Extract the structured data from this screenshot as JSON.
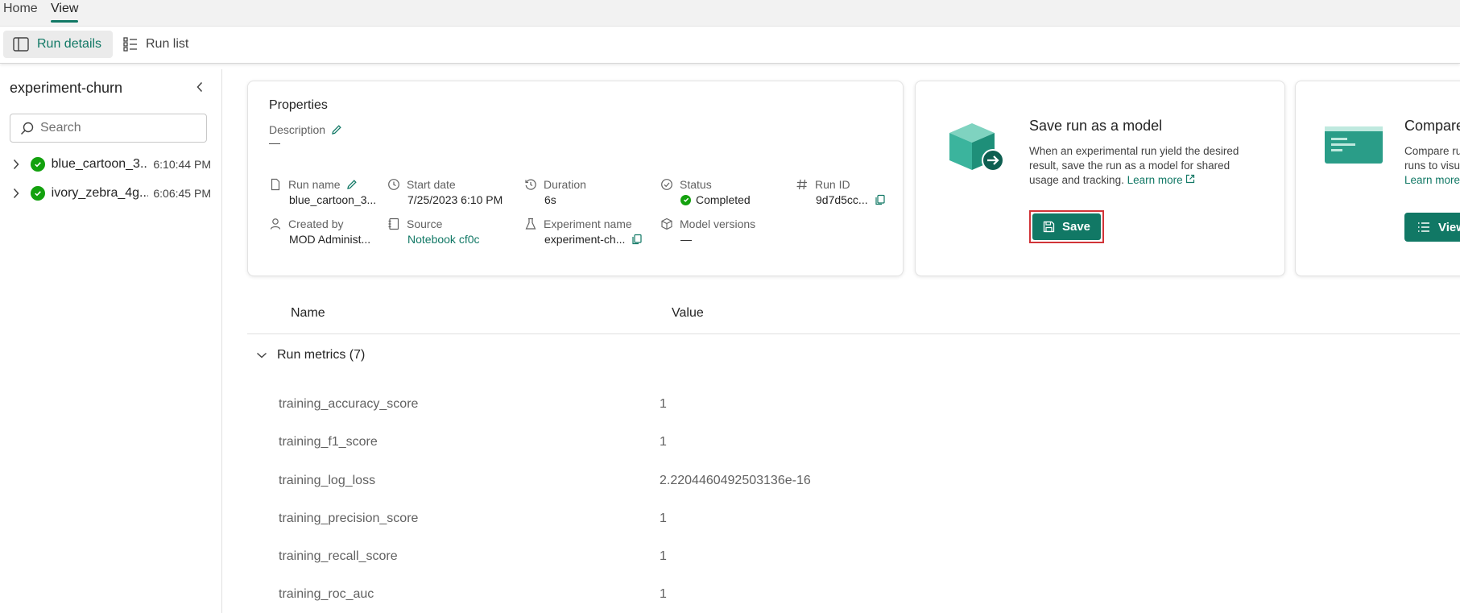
{
  "top_tabs": [
    {
      "label": "Home"
    },
    {
      "label": "View"
    }
  ],
  "ribbon": {
    "run_details": "Run details",
    "run_list": "Run list"
  },
  "sidebar": {
    "title": "experiment-churn",
    "search_placeholder": "Search",
    "runs": [
      {
        "name": "blue_cartoon_3...",
        "time": "6:10:44 PM",
        "status": "completed"
      },
      {
        "name": "ivory_zebra_4g...",
        "time": "6:06:45 PM",
        "status": "completed"
      }
    ]
  },
  "properties": {
    "title": "Properties",
    "description_label": "Description",
    "description_value": "—",
    "run_name_label": "Run name",
    "run_name": "blue_cartoon_3...",
    "start_date_label": "Start date",
    "start_date": "7/25/2023 6:10 PM",
    "duration_label": "Duration",
    "duration": "6s",
    "status_label": "Status",
    "status": "Completed",
    "run_id_label": "Run ID",
    "run_id": "9d7d5cc...",
    "created_by_label": "Created by",
    "created_by": "MOD Administ...",
    "source_label": "Source",
    "source": "Notebook cf0c",
    "experiment_name_label": "Experiment name",
    "experiment_name": "experiment-ch...",
    "model_versions_label": "Model versions",
    "model_versions": "—"
  },
  "save_card": {
    "title": "Save run as a model",
    "description": "When an experimental run yield the desired result, save the run as a model for shared usage and tracking.",
    "learn_more": "Learn more",
    "button": "Save"
  },
  "compare_card": {
    "title": "Compare",
    "description_line1": "Compare ru",
    "description_line2": "runs to visu",
    "learn_more": "Learn more",
    "button": "View"
  },
  "table": {
    "headers": {
      "name": "Name",
      "value": "Value"
    },
    "group_label": "Run metrics (7)",
    "rows": [
      {
        "name": "training_accuracy_score",
        "value": "1"
      },
      {
        "name": "training_f1_score",
        "value": "1"
      },
      {
        "name": "training_log_loss",
        "value": "2.2204460492503136e-16"
      },
      {
        "name": "training_precision_score",
        "value": "1"
      },
      {
        "name": "training_recall_score",
        "value": "1"
      },
      {
        "name": "training_roc_auc",
        "value": "1"
      }
    ]
  },
  "colors": {
    "accent": "#117865",
    "success": "#13a10e",
    "highlight": "#d13438"
  }
}
